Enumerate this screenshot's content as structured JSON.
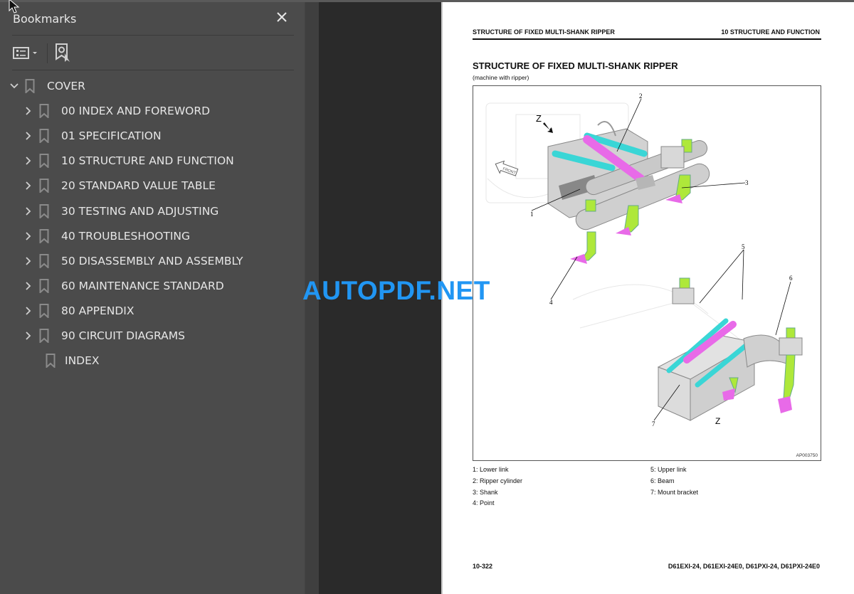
{
  "sidebar": {
    "title": "Bookmarks",
    "close_icon": "close-icon",
    "toolbar": {
      "options_icon": "list-options-icon",
      "find_icon": "find-current-bookmark-icon"
    },
    "items": [
      {
        "label": "COVER",
        "expander": "chevron-down",
        "level": 0
      },
      {
        "label": "00 INDEX AND FOREWORD",
        "expander": "chevron-right",
        "level": 1
      },
      {
        "label": "01 SPECIFICATION",
        "expander": "chevron-right",
        "level": 1
      },
      {
        "label": "10 STRUCTURE AND FUNCTION",
        "expander": "chevron-right",
        "level": 1
      },
      {
        "label": "20 STANDARD VALUE TABLE",
        "expander": "chevron-right",
        "level": 1
      },
      {
        "label": "30 TESTING AND ADJUSTING",
        "expander": "chevron-right",
        "level": 1
      },
      {
        "label": "40 TROUBLESHOOTING",
        "expander": "chevron-right",
        "level": 1
      },
      {
        "label": "50 DISASSEMBLY AND ASSEMBLY",
        "expander": "chevron-right",
        "level": 1
      },
      {
        "label": "60 MAINTENANCE STANDARD",
        "expander": "chevron-right",
        "level": 1
      },
      {
        "label": "80 APPENDIX",
        "expander": "chevron-right",
        "level": 1
      },
      {
        "label": "90 CIRCUIT DIAGRAMS",
        "expander": "chevron-right",
        "level": 1
      },
      {
        "label": "INDEX",
        "expander": "none",
        "level": 1
      }
    ]
  },
  "watermark": "AUTOPDF.NET",
  "page": {
    "header_left": "STRUCTURE OF FIXED MULTI-SHANK RIPPER",
    "header_right": "10 STRUCTURE AND FUNCTION",
    "title": "STRUCTURE OF FIXED MULTI-SHANK RIPPER",
    "subtitle": "(machine with ripper)",
    "figure": {
      "id": "AP003750",
      "view_label_top": "Z",
      "view_label_bottom": "Z",
      "front_label": "FRONT",
      "callouts": [
        "1",
        "2",
        "3",
        "4",
        "5",
        "6",
        "7"
      ],
      "colors": {
        "upper_link": "#3ad6d6",
        "cylinder": "#e86ae8",
        "shank": "#aee83a",
        "point": "#e86ae8",
        "steel": "#c9c9c9"
      }
    },
    "legend_left": [
      "1: Lower link",
      "2: Ripper cylinder",
      "3: Shank",
      "4: Point"
    ],
    "legend_right": [
      "5: Upper link",
      "6: Beam",
      "7: Mount bracket"
    ],
    "footer_left": "10-322",
    "footer_right": "D61EXI-24, D61EXI-24E0, D61PXI-24, D61PXI-24E0"
  }
}
